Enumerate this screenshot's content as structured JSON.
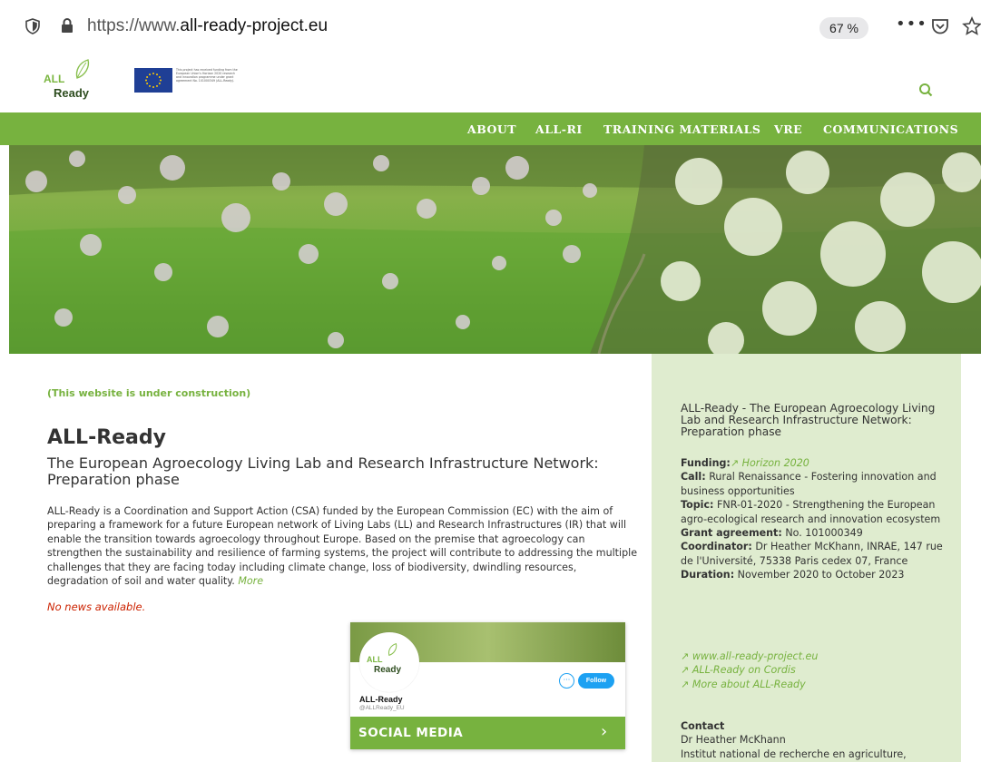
{
  "browser": {
    "url_prefix": "https://www.",
    "url_domain": "all-ready-project.eu",
    "zoom": "67 %",
    "icons": [
      "shield-icon",
      "lock-icon",
      "more-icon",
      "pocket-icon",
      "star-icon"
    ]
  },
  "header": {
    "logo_all": "ALL",
    "logo_ready": "Ready",
    "eu_text": "This project has received funding from the European Union's Horizon 2020 research and innovation programme under grant agreement No. 101000349 (ALL-Ready)."
  },
  "nav": {
    "items": [
      "ABOUT",
      "ALL-RI",
      "TRAINING MATERIALS",
      "VRE",
      "COMMUNICATIONS"
    ]
  },
  "main": {
    "construction": "(This website is under construction)",
    "title": "ALL-Ready",
    "subtitle": "The European Agroecology Living Lab and Research Infrastructure Network: Preparation phase",
    "intro": "ALL-Ready is a Coordination and Support Action (CSA) funded by the European Commission (EC) with the aim of preparing a framework for a future European network of Living Labs (LL) and Research Infrastructures (IR) that will enable the transition towards agroecology throughout Europe. Based on the premise that agroecology can strengthen the sustainability and resilience of farming systems, the project will contribute to addressing the multiple challenges that they are facing today including climate change, loss of biodiversity, dwindling resources, degradation of soil and water quality.",
    "more": "More",
    "no_news": "No news available."
  },
  "social": {
    "avatar_all": "ALL",
    "avatar_ready": "Ready",
    "dots": "···",
    "follow": "Follow",
    "name": "ALL-Ready",
    "handle": "@ALLReady_EU",
    "label": "SOCIAL MEDIA",
    "chevron": "›"
  },
  "sidebar": {
    "title": "ALL-Ready - The European Agroecology Living Lab and Research Infrastructure Network: Preparation phase",
    "funding_label": "Funding:",
    "funding_value": "↗ Horizon 2020",
    "call_label": "Call:",
    "call_value": " Rural Renaissance - Fostering innovation and business opportunities",
    "topic_label": "Topic:",
    "topic_value": " FNR-01-2020 - Strengthening the European agro-ecological research and innovation ecosystem",
    "grant_label": "Grant agreement:",
    "grant_value": " No. 101000349",
    "coord_label": "Coordinator:",
    "coord_value": " Dr Heather McKhann, INRAE, 147 rue de l'Université, 75338 Paris cedex 07, France",
    "duration_label": "Duration:",
    "duration_value": " November 2020 to October 2023",
    "links": [
      "↗ www.all-ready-project.eu",
      "↗ ALL-Ready on Cordis",
      "↗ More about ALL-Ready"
    ],
    "contact_label": "Contact",
    "contact_name": "Dr Heather McKhann",
    "contact_org": "Institut national de recherche en agriculture,"
  }
}
